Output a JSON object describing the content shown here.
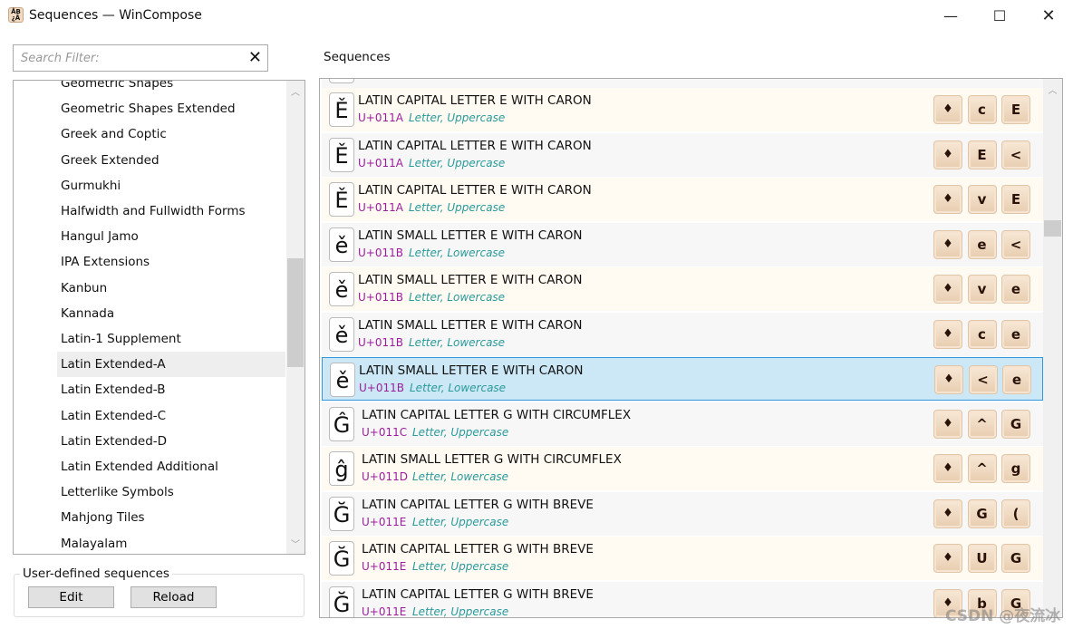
{
  "window": {
    "title": "Sequences — WinCompose",
    "icon": "wincompose-app-icon",
    "icon_text": "ÅB ¿Å",
    "controls": [
      "minimize",
      "maximize",
      "close"
    ]
  },
  "search": {
    "placeholder": "Search Filter:",
    "value": "",
    "clear_icon": "✕"
  },
  "categories": {
    "items": [
      "Geometric Shapes",
      "Geometric Shapes Extended",
      "Greek and Coptic",
      "Greek Extended",
      "Gurmukhi",
      "Halfwidth and Fullwidth Forms",
      "Hangul Jamo",
      "IPA Extensions",
      "Kanbun",
      "Kannada",
      "Latin-1 Supplement",
      "Latin Extended-A",
      "Latin Extended-B",
      "Latin Extended-C",
      "Latin Extended-D",
      "Latin Extended Additional",
      "Letterlike Symbols",
      "Mahjong Tiles",
      "Malayalam"
    ],
    "selected": "Latin Extended-A"
  },
  "user_defined": {
    "label": "User-defined sequences",
    "edit": "Edit",
    "reload": "Reload"
  },
  "sequences": {
    "label": "Sequences",
    "compose_key": "♦",
    "rows": [
      {
        "glyph": "Ě",
        "name": "LATIN CAPITAL LETTER E WITH CARON",
        "code": "U+011A",
        "category": "Letter, Uppercase",
        "keys": [
          "♦",
          "c",
          "E"
        ]
      },
      {
        "glyph": "Ě",
        "name": "LATIN CAPITAL LETTER E WITH CARON",
        "code": "U+011A",
        "category": "Letter, Uppercase",
        "keys": [
          "♦",
          "E",
          "<"
        ]
      },
      {
        "glyph": "Ě",
        "name": "LATIN CAPITAL LETTER E WITH CARON",
        "code": "U+011A",
        "category": "Letter, Uppercase",
        "keys": [
          "♦",
          "v",
          "E"
        ]
      },
      {
        "glyph": "ě",
        "name": "LATIN SMALL LETTER E WITH CARON",
        "code": "U+011B",
        "category": "Letter, Lowercase",
        "keys": [
          "♦",
          "e",
          "<"
        ]
      },
      {
        "glyph": "ě",
        "name": "LATIN SMALL LETTER E WITH CARON",
        "code": "U+011B",
        "category": "Letter, Lowercase",
        "keys": [
          "♦",
          "v",
          "e"
        ]
      },
      {
        "glyph": "ě",
        "name": "LATIN SMALL LETTER E WITH CARON",
        "code": "U+011B",
        "category": "Letter, Lowercase",
        "keys": [
          "♦",
          "c",
          "e"
        ]
      },
      {
        "glyph": "ě",
        "name": "LATIN SMALL LETTER E WITH CARON",
        "code": "U+011B",
        "category": "Letter, Lowercase",
        "keys": [
          "♦",
          "<",
          "e"
        ],
        "selected": true
      },
      {
        "glyph": "Ĝ",
        "name": "LATIN CAPITAL LETTER G WITH CIRCUMFLEX",
        "code": "U+011C",
        "category": "Letter, Uppercase",
        "keys": [
          "♦",
          "^",
          "G"
        ]
      },
      {
        "glyph": "ĝ",
        "name": "LATIN SMALL LETTER G WITH CIRCUMFLEX",
        "code": "U+011D",
        "category": "Letter, Lowercase",
        "keys": [
          "♦",
          "^",
          "g"
        ]
      },
      {
        "glyph": "Ğ",
        "name": "LATIN CAPITAL LETTER G WITH BREVE",
        "code": "U+011E",
        "category": "Letter, Uppercase",
        "keys": [
          "♦",
          "G",
          "("
        ]
      },
      {
        "glyph": "Ğ",
        "name": "LATIN CAPITAL LETTER G WITH BREVE",
        "code": "U+011E",
        "category": "Letter, Uppercase",
        "keys": [
          "♦",
          "U",
          "G"
        ]
      },
      {
        "glyph": "Ğ",
        "name": "LATIN CAPITAL LETTER G WITH BREVE",
        "code": "U+011E",
        "category": "Letter, Uppercase",
        "keys": [
          "♦",
          "b",
          "G"
        ]
      }
    ]
  },
  "watermark": "CSDN @夜流冰"
}
